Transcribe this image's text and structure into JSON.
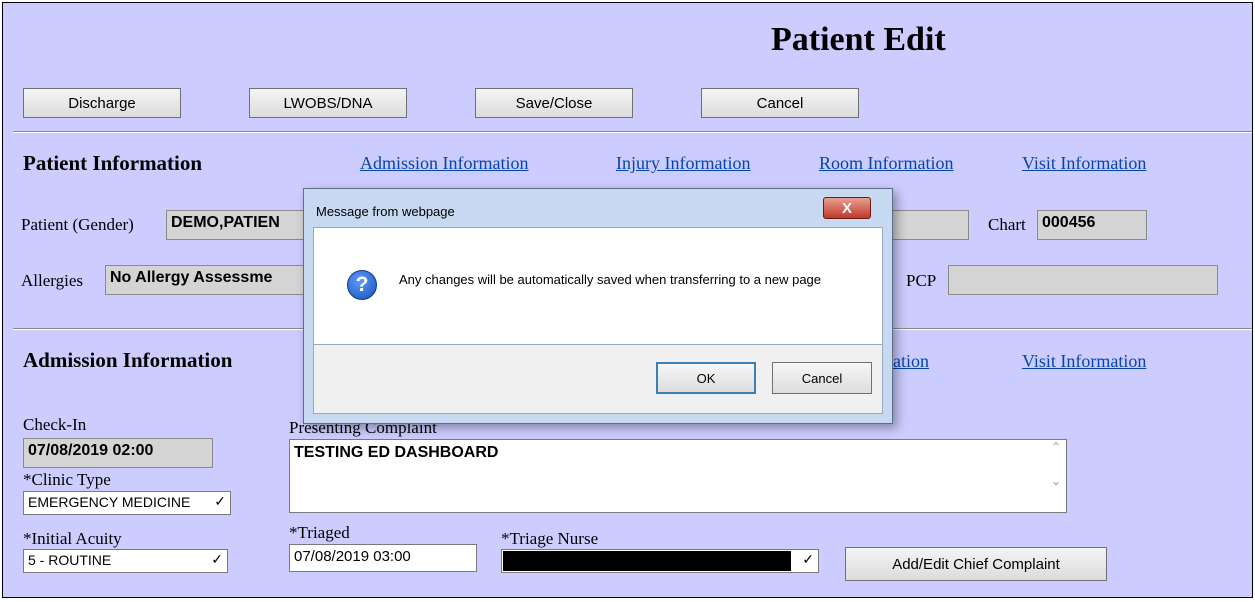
{
  "page": {
    "title": "Patient Edit"
  },
  "toolbar": {
    "discharge": "Discharge",
    "lwobs": "LWOBS/DNA",
    "save_close": "Save/Close",
    "cancel": "Cancel"
  },
  "patient_info": {
    "heading": "Patient Information",
    "links": [
      "Admission Information",
      "Injury Information",
      "Room Information",
      "Visit Information"
    ],
    "patient_label": "Patient (Gender)",
    "patient_value": "DEMO,PATIEN",
    "chart_label": "Chart",
    "chart_value": "000456",
    "allergies_label": "Allergies",
    "allergies_value": "No Allergy Assessme",
    "pcp_label": "PCP",
    "pcp_value": ""
  },
  "admission": {
    "heading": "Admission Information",
    "link_partial": "ation",
    "link_visit": "Visit Information",
    "checkin_label": "Check-In",
    "checkin_value": "07/08/2019 02:00",
    "complaint_label": "Presenting Complaint",
    "complaint_value": "TESTING ED DASHBOARD",
    "clinic_label": "*Clinic Type",
    "clinic_value": "EMERGENCY MEDICINE",
    "acuity_label": "*Initial Acuity",
    "acuity_value": "5 - ROUTINE",
    "triaged_label": "*Triaged",
    "triaged_value": "07/08/2019 03:00",
    "nurse_label": "*Triage Nurse",
    "chief_btn": "Add/Edit Chief Complaint"
  },
  "dialog": {
    "title": "Message from webpage",
    "close": "X",
    "icon": "question-icon",
    "message": "Any changes will be automatically saved when transferring to a new page",
    "ok": "OK",
    "cancel": "Cancel"
  }
}
